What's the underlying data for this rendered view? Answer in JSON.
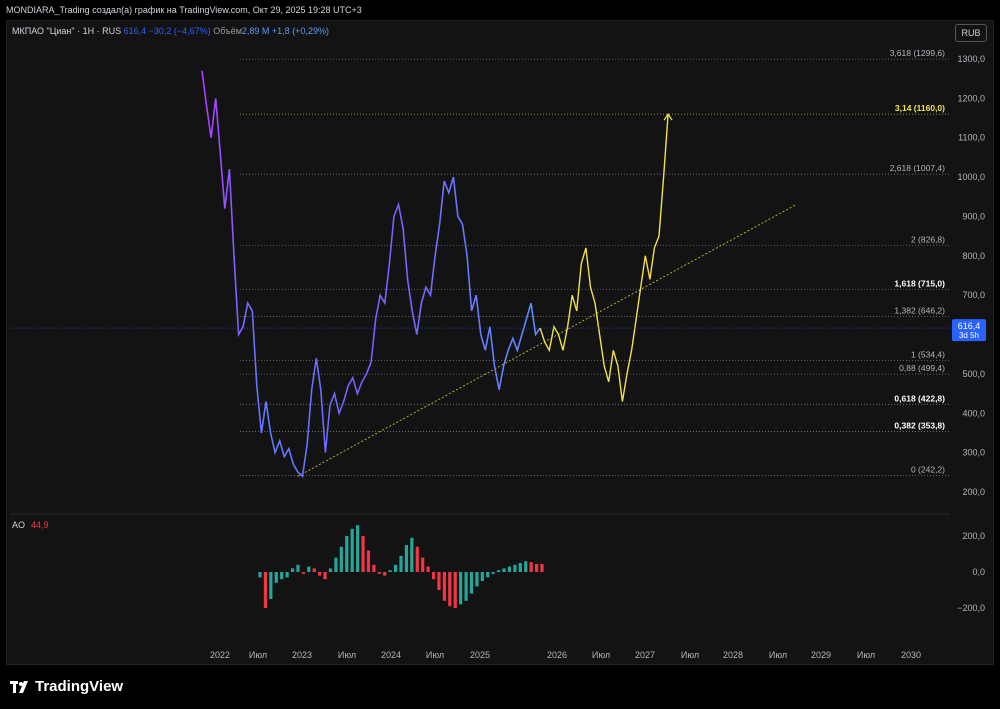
{
  "header": {
    "attribution": "MONDIARA_Trading создал(а) график на TradingView.com, Окт 29, 2025 19:28 UTC+3"
  },
  "legend": {
    "symbol": "МКПАО \"Циан\" · 1Н · RUS",
    "price": "616,4",
    "change": "−30,2 (−4,67%)",
    "volume_label": "Объём",
    "volume_value": "2,89 М",
    "volume_change": "+1,8 (+0,29%)"
  },
  "currency": "RUB",
  "price_axis": [
    "1300,0",
    "1200,0",
    "1100,0",
    "1000,0",
    "900,0",
    "800,0",
    "700,0",
    "600,0",
    "500,0",
    "400,0",
    "300,0",
    "200,0"
  ],
  "last_price": {
    "value": "616,4",
    "countdown": "3d 5h"
  },
  "fib_levels": [
    {
      "label": "3,618 (1299,6)",
      "value": 1299.6,
      "color": "#b2b5be",
      "bold": false
    },
    {
      "label": "3,14 (1160,0)",
      "value": 1160.0,
      "color": "#f2e14c",
      "bold": true
    },
    {
      "label": "2,618 (1007,4)",
      "value": 1007.4,
      "color": "#b2b5be",
      "bold": false
    },
    {
      "label": "2 (826,8)",
      "value": 826.8,
      "color": "#b2b5be",
      "bold": false
    },
    {
      "label": "1,618 (715,0)",
      "value": 715.0,
      "color": "#ffffff",
      "bold": true
    },
    {
      "label": "1,382 (646,2)",
      "value": 646.2,
      "color": "#b2b5be",
      "bold": false
    },
    {
      "label": "1 (534,4)",
      "value": 534.4,
      "color": "#b2b5be",
      "bold": false
    },
    {
      "label": "0,88 (499,4)",
      "value": 499.4,
      "color": "#b2b5be",
      "bold": false
    },
    {
      "label": "0,618 (422,8)",
      "value": 422.8,
      "color": "#ffffff",
      "bold": true
    },
    {
      "label": "0,382 (353,8)",
      "value": 353.8,
      "color": "#ffffff",
      "bold": true
    },
    {
      "label": "0 (242,2)",
      "value": 242.2,
      "color": "#b2b5be",
      "bold": false
    }
  ],
  "ao": {
    "label": "AO",
    "value": "44,9",
    "axis": [
      "200,0",
      "0,0",
      "−200,0"
    ]
  },
  "time_axis": [
    "2022",
    "Июл",
    "2023",
    "Июл",
    "2024",
    "Июл",
    "2025",
    "2026",
    "Июл",
    "2027",
    "Июл",
    "2028",
    "Июл",
    "2029",
    "Июл",
    "2030"
  ],
  "brand": "TradingView",
  "chart_data": {
    "type": "line",
    "ylim": [
      200,
      1340
    ],
    "price_history": [
      [
        0,
        1270
      ],
      [
        1,
        1180
      ],
      [
        2,
        1100
      ],
      [
        3,
        1200
      ],
      [
        4,
        1060
      ],
      [
        5,
        920
      ],
      [
        6,
        1020
      ],
      [
        7,
        800
      ],
      [
        8,
        600
      ],
      [
        9,
        620
      ],
      [
        10,
        680
      ],
      [
        11,
        660
      ],
      [
        12,
        470
      ],
      [
        13,
        350
      ],
      [
        14,
        430
      ],
      [
        15,
        350
      ],
      [
        16,
        300
      ],
      [
        17,
        330
      ],
      [
        18,
        290
      ],
      [
        19,
        310
      ],
      [
        20,
        270
      ],
      [
        21,
        250
      ],
      [
        22,
        240
      ],
      [
        23,
        320
      ],
      [
        24,
        460
      ],
      [
        25,
        540
      ],
      [
        26,
        460
      ],
      [
        27,
        300
      ],
      [
        28,
        420
      ],
      [
        29,
        450
      ],
      [
        30,
        400
      ],
      [
        31,
        430
      ],
      [
        32,
        470
      ],
      [
        33,
        490
      ],
      [
        34,
        450
      ],
      [
        35,
        480
      ],
      [
        36,
        500
      ],
      [
        37,
        530
      ],
      [
        38,
        640
      ],
      [
        39,
        700
      ],
      [
        40,
        680
      ],
      [
        41,
        780
      ],
      [
        42,
        900
      ],
      [
        43,
        930
      ],
      [
        44,
        870
      ],
      [
        45,
        740
      ],
      [
        46,
        660
      ],
      [
        47,
        600
      ],
      [
        48,
        680
      ],
      [
        49,
        720
      ],
      [
        50,
        700
      ],
      [
        51,
        800
      ],
      [
        52,
        880
      ],
      [
        53,
        990
      ],
      [
        54,
        960
      ],
      [
        55,
        1000
      ],
      [
        56,
        900
      ],
      [
        57,
        880
      ],
      [
        58,
        800
      ],
      [
        59,
        660
      ],
      [
        60,
        700
      ],
      [
        61,
        600
      ],
      [
        62,
        560
      ],
      [
        63,
        620
      ],
      [
        64,
        520
      ],
      [
        65,
        460
      ],
      [
        66,
        520
      ],
      [
        67,
        560
      ],
      [
        68,
        590
      ],
      [
        69,
        560
      ],
      [
        70,
        600
      ],
      [
        71,
        640
      ],
      [
        72,
        680
      ],
      [
        73,
        600
      ],
      [
        74,
        616
      ]
    ],
    "projection": [
      [
        74,
        616
      ],
      [
        75,
        580
      ],
      [
        76,
        560
      ],
      [
        77,
        620
      ],
      [
        78,
        600
      ],
      [
        79,
        560
      ],
      [
        80,
        620
      ],
      [
        81,
        700
      ],
      [
        82,
        660
      ],
      [
        83,
        780
      ],
      [
        84,
        820
      ],
      [
        85,
        720
      ],
      [
        86,
        680
      ],
      [
        87,
        600
      ],
      [
        88,
        520
      ],
      [
        89,
        480
      ],
      [
        90,
        560
      ],
      [
        91,
        520
      ],
      [
        92,
        430
      ],
      [
        93,
        500
      ],
      [
        94,
        560
      ],
      [
        95,
        640
      ],
      [
        96,
        720
      ],
      [
        97,
        800
      ],
      [
        98,
        740
      ],
      [
        99,
        820
      ],
      [
        100,
        850
      ],
      [
        101,
        1000
      ],
      [
        102,
        1160
      ]
    ],
    "trendline": [
      [
        21,
        240
      ],
      [
        130,
        930
      ]
    ],
    "ao_values": [
      -30,
      -200,
      -150,
      -60,
      -40,
      -30,
      20,
      40,
      -10,
      30,
      20,
      -20,
      -40,
      20,
      80,
      140,
      200,
      240,
      260,
      200,
      120,
      40,
      -10,
      -20,
      10,
      40,
      90,
      150,
      190,
      140,
      80,
      30,
      -40,
      -100,
      -160,
      -190,
      -200,
      -180,
      -160,
      -120,
      -80,
      -50,
      -30,
      -10,
      10,
      20,
      30,
      40,
      50,
      60,
      55,
      45,
      44.9
    ]
  }
}
